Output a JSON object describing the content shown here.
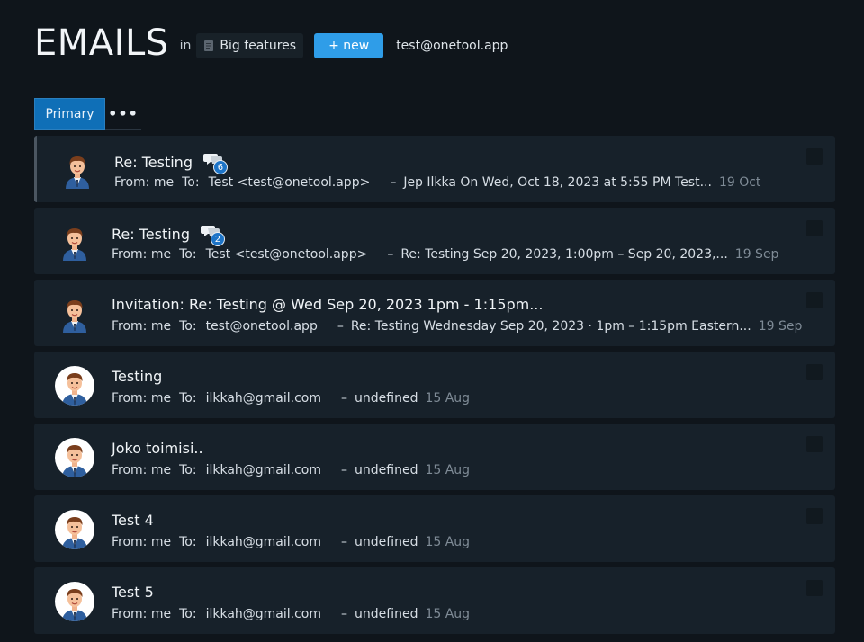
{
  "header": {
    "title": "EMAILS",
    "in_label": "in",
    "project": "Big features",
    "new_button": "+ new",
    "account": "test@onetool.app"
  },
  "tabs": {
    "primary": "Primary",
    "more": "•••"
  },
  "emails": [
    {
      "subject": "Re: Testing",
      "thread_count": "6",
      "from_label": "From: me",
      "to_label": "To:",
      "to": "Test <test@onetool.app>",
      "separator": "–",
      "snippet": "Jep Ilkka On Wed, Oct 18, 2023 at 5:55 PM Test...",
      "date": "19 Oct"
    },
    {
      "subject": "Re: Testing",
      "thread_count": "2",
      "from_label": "From: me",
      "to_label": "To:",
      "to": "Test <test@onetool.app>",
      "separator": "–",
      "snippet": "Re: Testing Sep 20, 2023, 1:00pm – Sep 20, 2023,...",
      "date": "19 Sep"
    },
    {
      "subject": "Invitation: Re: Testing @ Wed Sep 20, 2023 1pm - 1:15pm...",
      "from_label": "From: me",
      "to_label": "To:",
      "to": "test@onetool.app",
      "separator": "–",
      "snippet": "Re: Testing Wednesday Sep 20, 2023 · 1pm – 1:15pm Eastern...",
      "date": "19 Sep"
    },
    {
      "subject": "Testing",
      "from_label": "From: me",
      "to_label": "To:",
      "to": "ilkkah@gmail.com",
      "separator": "–",
      "snippet": "undefined",
      "date": "15 Aug"
    },
    {
      "subject": "Joko toimisi..",
      "from_label": "From: me",
      "to_label": "To:",
      "to": "ilkkah@gmail.com",
      "separator": "–",
      "snippet": "undefined",
      "date": "15 Aug"
    },
    {
      "subject": "Test 4",
      "from_label": "From: me",
      "to_label": "To:",
      "to": "ilkkah@gmail.com",
      "separator": "–",
      "snippet": "undefined",
      "date": "15 Aug"
    },
    {
      "subject": "Test 5",
      "from_label": "From: me",
      "to_label": "To:",
      "to": "ilkkah@gmail.com",
      "separator": "–",
      "snippet": "undefined",
      "date": "15 Aug"
    }
  ],
  "colors": {
    "background": "#0f151b",
    "row": "#17212a",
    "accent": "#2f9de8",
    "tab_active": "#0f6fb7"
  }
}
